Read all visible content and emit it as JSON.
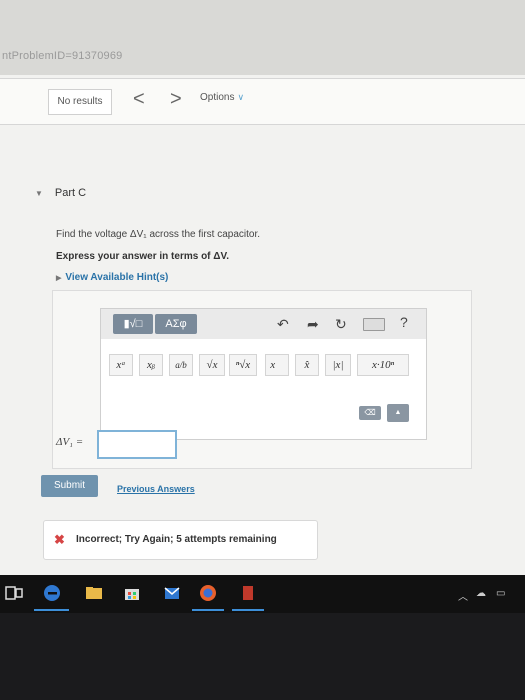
{
  "browser": {
    "url_fragment": "ntProblemID=91370969"
  },
  "nav": {
    "search_status": "No results",
    "prev_glyph": "<",
    "next_glyph": ">",
    "options_label": "Options",
    "options_chevron": "∨"
  },
  "part": {
    "label": "Part C"
  },
  "question": {
    "prompt": "Find the voltage ΔV₁ across the first capacitor.",
    "instruction": "Express your answer in terms of ΔV.",
    "hints_label": "View Available Hint(s)"
  },
  "toolbar": {
    "templates_label": "▮√□",
    "greek_label": "ΑΣφ",
    "undo_glyph": "↶",
    "redo_glyph": "➦",
    "reset_glyph": "↻",
    "help_glyph": "?"
  },
  "math_buttons": [
    {
      "name": "superscript",
      "label": "xᵃ"
    },
    {
      "name": "subscript",
      "label": "xᵦ"
    },
    {
      "name": "fraction",
      "label": "a/b"
    },
    {
      "name": "square-root",
      "label": "√x"
    },
    {
      "name": "nth-root",
      "label": "ⁿ√x"
    },
    {
      "name": "vector",
      "label": "x⃗"
    },
    {
      "name": "unit-vector",
      "label": "x̂"
    },
    {
      "name": "absolute-value",
      "label": "|x|"
    },
    {
      "name": "scientific-notation",
      "label": "x·10ⁿ"
    }
  ],
  "backspace_glyph": "⌫",
  "answer": {
    "variable_label": "ΔV₁ =",
    "value": ""
  },
  "submit_label": "Submit",
  "previous_answers_label": "Previous Answers",
  "feedback": {
    "icon": "✖",
    "message": "Incorrect; Try Again; 5 attempts remaining"
  },
  "colors": {
    "accent_blue": "#2a73a8",
    "submit_bg": "#6f93ae",
    "error_red": "#d64545",
    "toolbar_button": "#7a8a9a"
  }
}
